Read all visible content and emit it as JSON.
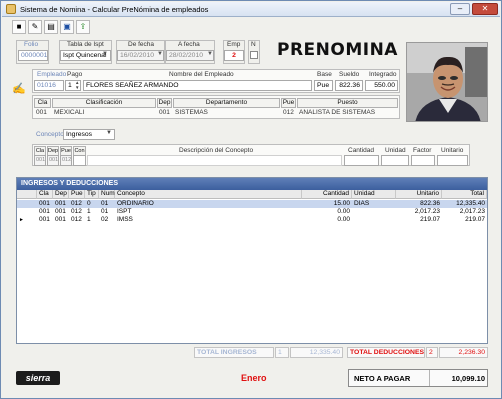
{
  "window": {
    "title": "Sistema de Nomina - Calcular PreNómina de empleados",
    "minimize": "–",
    "close": "✕"
  },
  "toolbar": [
    "save-icon",
    "edit-icon",
    "print-icon",
    "window-icon",
    "export-icon"
  ],
  "header": {
    "folio_label": "Folio",
    "folio": "00000017",
    "tabla_label": "Tabla de Ispt",
    "tabla": "Ispt Quincenal",
    "de_fecha_label": "De fecha",
    "de_fecha": "16/02/2010",
    "a_fecha_label": "A fecha",
    "a_fecha": "28/02/2010",
    "emp_label": "Emp",
    "emp": "2",
    "n_label": "N",
    "brand": "PRENOMINA"
  },
  "employee": {
    "empleado_label": "Empleado",
    "empleado": "01016",
    "pago_label": "Pago",
    "pago": "1",
    "nombre_label": "Nombre del Empleado",
    "nombre": "FLORES SEAÑEZ ARMANDO",
    "base_label": "Base",
    "base": "Pue",
    "sueldo_label": "Sueldo",
    "sueldo": "822.36",
    "integrado_label": "Integrado",
    "integrado": "550.00"
  },
  "classification": {
    "cla_label": "Cla",
    "cla": "001",
    "clasif_label": "Clasificación",
    "clasif": "MEXICALI",
    "dep_label": "Dep",
    "dep": "001",
    "depto_label": "Departamento",
    "depto": "SISTEMAS",
    "pue_label": "Pue",
    "pue": "012",
    "puesto_label": "Puesto",
    "puesto": "ANALISTA DE SISTEMAS"
  },
  "concept_selector": {
    "label": "Concepto",
    "value": "Ingresos"
  },
  "concept_entry": {
    "cla_label": "Cla",
    "dep_label": "Dep",
    "pue_label": "Pue",
    "con_label": "Con",
    "cla": "001",
    "dep": "001",
    "pue": "012",
    "desc_label": "Descripción del Concepto",
    "cantidad_label": "Cantidad",
    "unidad_label": "Unidad",
    "factor_label": "Factor",
    "unitario_label": "Unitario"
  },
  "grid": {
    "title": "INGRESOS Y DEDUCCIONES",
    "columns": [
      "Cla",
      "Dep",
      "Pue",
      "Tip",
      "Num",
      "Concepto",
      "Cantidad",
      "Unidad",
      "Unitario",
      "Total"
    ],
    "rows": [
      {
        "indicator": "",
        "cla": "001",
        "dep": "001",
        "pue": "012",
        "tip": "0",
        "num": "01",
        "concepto": "ORDINARIO",
        "cantidad": "15.00",
        "unidad": "DIAS",
        "unitario": "822.36",
        "total": "12,335.40"
      },
      {
        "indicator": "",
        "cla": "001",
        "dep": "001",
        "pue": "012",
        "tip": "1",
        "num": "01",
        "concepto": "ISPT",
        "cantidad": "0.00",
        "unidad": "",
        "unitario": "2,017.23",
        "total": "2,017.23"
      },
      {
        "indicator": "►",
        "cla": "001",
        "dep": "001",
        "pue": "012",
        "tip": "1",
        "num": "02",
        "concepto": "IMSS",
        "cantidad": "0.00",
        "unidad": "",
        "unitario": "219.07",
        "total": "219.07"
      }
    ]
  },
  "totals": {
    "ingresos_label": "TOTAL INGRESOS",
    "ingresos_count": "1",
    "ingresos": "12,335.40",
    "deducciones_label": "TOTAL DEDUCCIONES",
    "deducciones_count": "2",
    "deducciones": "2,236.30"
  },
  "footer": {
    "logo": "sierra",
    "month": "Enero",
    "neto_label": "NETO A PAGAR",
    "neto": "10,099.10"
  },
  "colors": {
    "accent": "#3c5f9e",
    "red": "#e01010",
    "blue_label": "#6d86b8"
  }
}
